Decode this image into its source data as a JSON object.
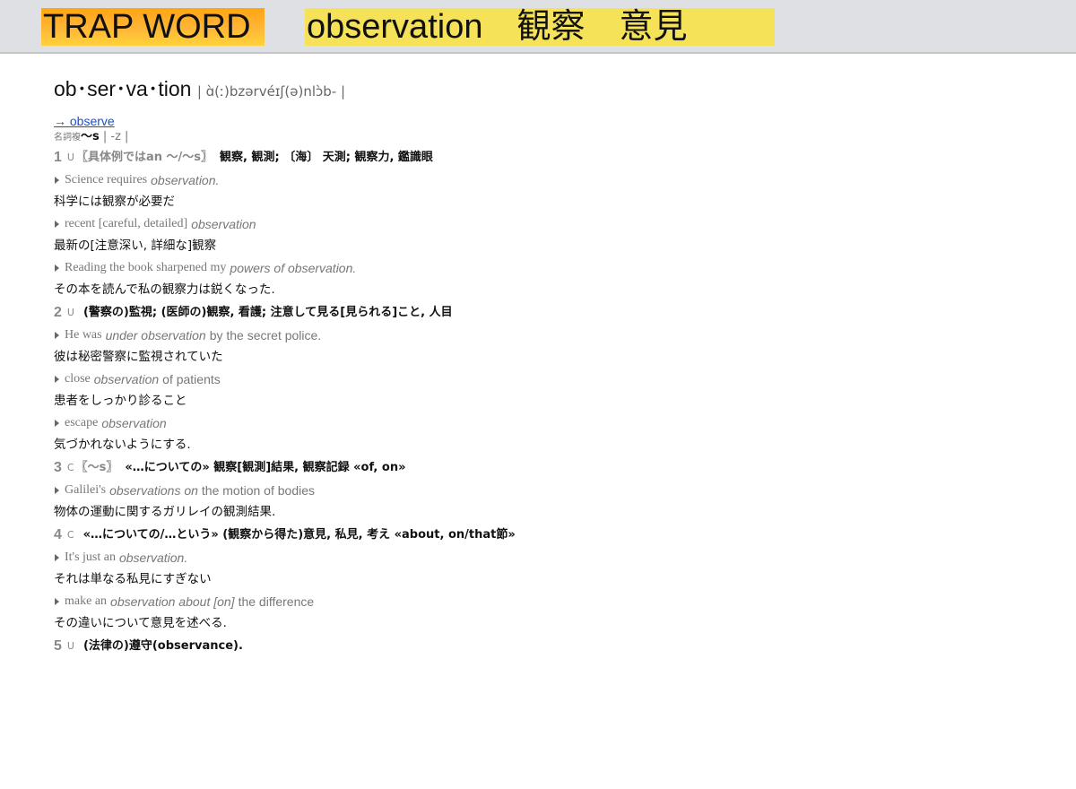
{
  "banner": {
    "label": "TRAP WORD",
    "word": "observation",
    "meaning1": "観察",
    "meaning2": "意見"
  },
  "entry": {
    "headword": "ob･ser･va･tion",
    "pronunciation": "| ɑ̀(ː)bzərvéɪʃ(ə)nlɔ̀b- |",
    "xref": "→ observe",
    "inflection_label": "名詞複",
    "inflection_form": "〜s",
    "inflection_pron": " | -z |"
  },
  "senses": [
    {
      "num": "1",
      "code": "U",
      "label": "〖具体例ではan 〜/〜s〗",
      "def": "観察, 観測; 〔海〕 天測; 観察力, 鑑識眼",
      "examples": [
        {
          "p1": "Science requires",
          "em": "observation.",
          "p2": "",
          "ja": "科学には観察が必要だ"
        },
        {
          "p1": "recent [careful, detailed]",
          "em": "observation",
          "p2": "",
          "ja": "最新の[注意深い, 詳細な]観察"
        },
        {
          "p1": "Reading the book sharpened my",
          "em": "powers of observation.",
          "p2": "",
          "ja": "その本を読んで私の観察力は鋭くなった."
        }
      ]
    },
    {
      "num": "2",
      "code": "U",
      "label": "",
      "def": "(警察の)監視; (医師の)観察, 看護; 注意して見る[見られる]こと, 人目",
      "examples": [
        {
          "p1": "He was",
          "em": "under observation",
          "p2": "by the secret police.",
          "ja": "彼は秘密警察に監視されていた"
        },
        {
          "p1": "close",
          "em": "observation",
          "p2": "of patients",
          "ja": "患者をしっかり診ること"
        },
        {
          "p1": "escape",
          "em": "observation",
          "p2": "",
          "ja": "気づかれないようにする."
        }
      ]
    },
    {
      "num": "3",
      "code": "C",
      "label": "〖〜s〗",
      "def": "«…についての» 観察[観測]結果, 観察記録 «of, on»",
      "examples": [
        {
          "p1": "Galilei's",
          "em": "observations on",
          "p2": "the motion of bodies",
          "ja": "物体の運動に関するガリレイの観測結果."
        }
      ]
    },
    {
      "num": "4",
      "code": "C",
      "label": "",
      "def": "«…についての/…という» (観察から得た)意見, 私見, 考え «about, on/that節»",
      "examples": [
        {
          "p1": "It's just an",
          "em": "observation.",
          "p2": "",
          "ja": "それは単なる私見にすぎない"
        },
        {
          "p1": "make an",
          "em": "observation about [on]",
          "p2": "the difference",
          "ja": "その違いについて意見を述べる."
        }
      ]
    },
    {
      "num": "5",
      "code": "U",
      "label": "",
      "def": "(法律の)遵守(observance).",
      "examples": []
    }
  ]
}
